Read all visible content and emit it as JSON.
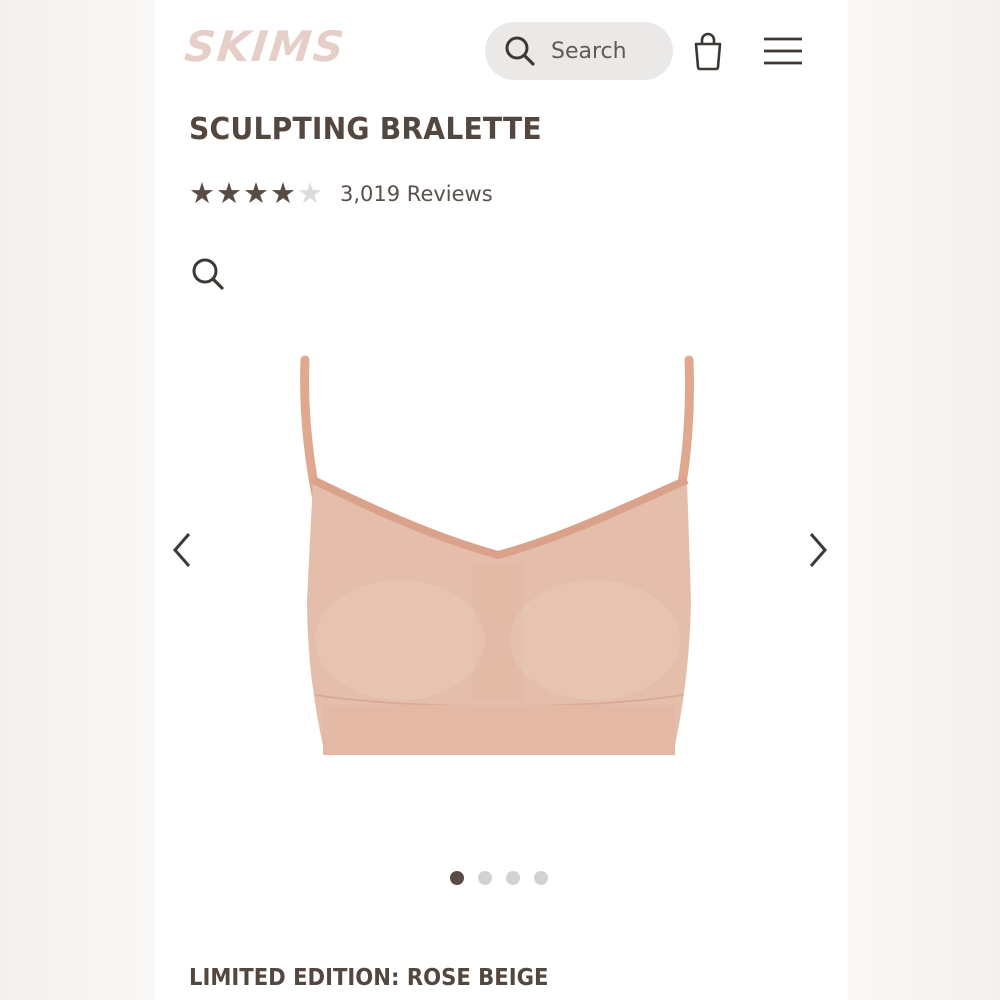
{
  "header": {
    "logo": "SKIMS",
    "search_placeholder": "Search"
  },
  "product": {
    "title": "SCULPTING BRALETTE",
    "rating": 4,
    "rating_max": 5,
    "reviews_label": "3,019 Reviews",
    "edition_label": "LIMITED EDITION: ROSE BEIGE",
    "image_alt_icon": "bralette-product-image",
    "color_hex": "#e3bba5"
  },
  "carousel": {
    "slides": 4,
    "active_index": 0
  },
  "colors": {
    "logo": "#e6cfc8",
    "text_dark": "#54473f",
    "star_filled": "#5a4c44",
    "star_empty": "#dcdcdc",
    "search_bg": "#ebe9e8"
  },
  "icons": {
    "search": "search-icon",
    "bag": "shopping-bag-icon",
    "menu": "hamburger-menu-icon",
    "zoom": "zoom-icon",
    "prev": "chevron-left-icon",
    "next": "chevron-right-icon"
  }
}
